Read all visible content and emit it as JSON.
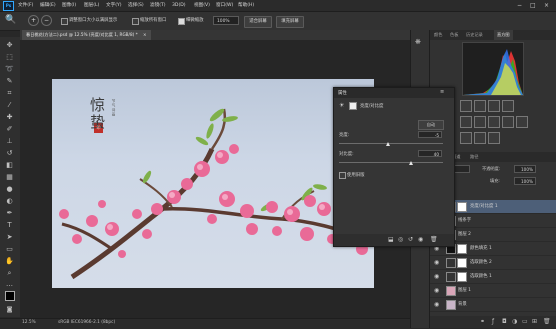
{
  "menubar": {
    "logo": "Ps",
    "items": [
      "文件(F)",
      "编辑(E)",
      "图像(I)",
      "图层(L)",
      "文字(Y)",
      "选择(S)",
      "滤镜(T)",
      "3D(D)",
      "视图(V)",
      "窗口(W)",
      "帮助(H)"
    ],
    "window_controls": [
      "−",
      "□",
      "×"
    ]
  },
  "options": {
    "zoom_in_symbol": "+",
    "zoom_out_symbol": "−",
    "resize_windows_label": "调整窗口大小以满屏显示",
    "zoom_all_label": "缩放所有窗口",
    "scrubby_zoom_label": "细微缩放",
    "zoom_value": "100%",
    "fit_screen_label": "适合屏幕",
    "fill_screen_label": "填充屏幕"
  },
  "document": {
    "tab_title": "春日桃花(方法二).psd @ 12.5% (亮度/对比度 1, RGB/8) *",
    "tab_close": "×",
    "art_title": "惊蛰",
    "art_small_text": "节气诗画",
    "seal_text": "印"
  },
  "status": {
    "zoom": "12.5%",
    "doc_info": "sRGB IEC61966-2.1 (8bpc)"
  },
  "right_panel": {
    "tabs": [
      "颜色",
      "色板",
      "历史记录",
      "直方图"
    ],
    "active_tab": "直方图"
  },
  "layers": {
    "tabs": [
      "图层",
      "通道",
      "路径"
    ],
    "blend_mode": "正常",
    "opacity_label": "不透明度:",
    "opacity_value": "100%",
    "lock_label": "锁定:",
    "fill_label": "填充:",
    "fill_value": "100%",
    "rows": [
      {
        "name": "亮度/对比度 1",
        "selected": true
      },
      {
        "name": "线条字",
        "selected": false
      },
      {
        "name": "图层 2",
        "selected": false
      },
      {
        "name": "颜色填充 1",
        "selected": false
      },
      {
        "name": "选取颜色 2",
        "selected": false
      },
      {
        "name": "选取颜色 1",
        "selected": false
      },
      {
        "name": "图层 1",
        "selected": false
      },
      {
        "name": "背景",
        "selected": false
      }
    ]
  },
  "properties": {
    "title": "属性",
    "adjustment_name": "亮度/对比度",
    "auto_label": "自动",
    "brightness_label": "亮度:",
    "brightness_value": "-5",
    "brightness_level": 0.48,
    "contrast_label": "对比度:",
    "contrast_value": "40",
    "contrast_level": 0.7,
    "legacy_label": "使用旧版"
  },
  "colors": {
    "accent": "#31a8ff",
    "selected_layer": "#4d5f78",
    "blossom": "#e96a97"
  }
}
